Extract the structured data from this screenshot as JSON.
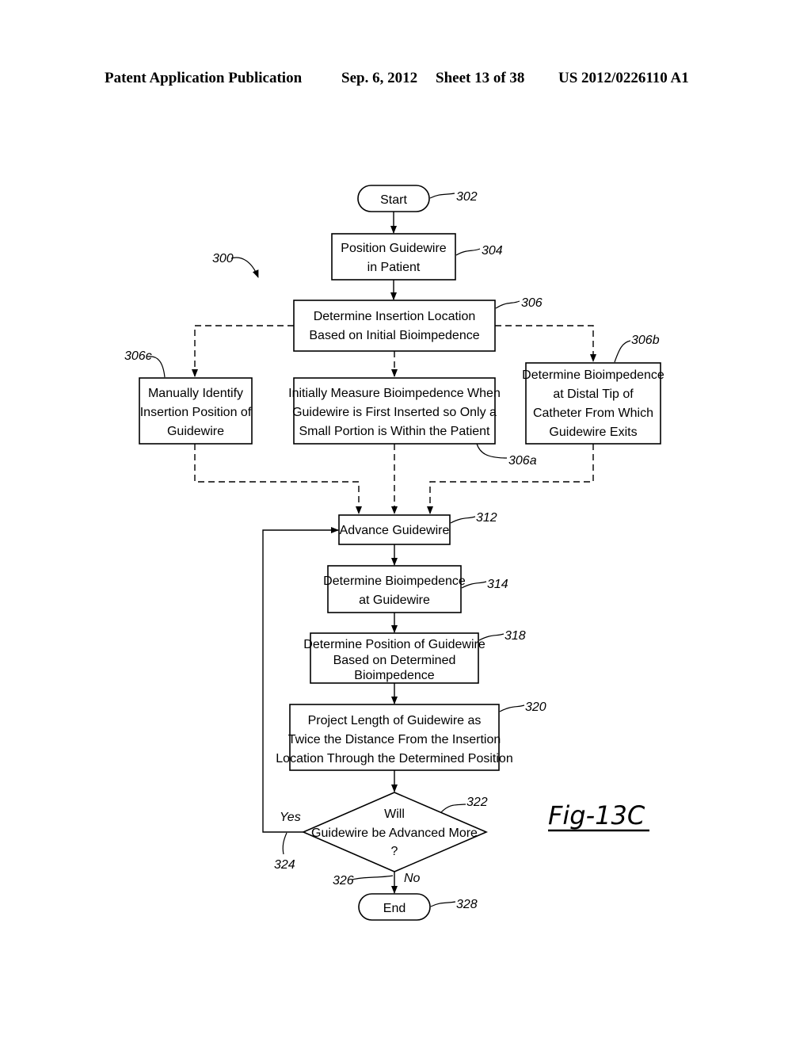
{
  "header": {
    "publication": "Patent Application Publication",
    "date": "Sep. 6, 2012",
    "sheet": "Sheet 13 of 38",
    "number": "US 2012/0226110 A1"
  },
  "figure": {
    "label": "Fig-13C",
    "ref": "300"
  },
  "nodes": {
    "start": {
      "ref": "302",
      "lines": [
        "Start"
      ]
    },
    "n304": {
      "ref": "304",
      "lines": [
        "Position Guidewire",
        "in Patient"
      ]
    },
    "n306": {
      "ref": "306",
      "lines": [
        "Determine Insertion Location",
        "Based on Initial Bioimpedence"
      ]
    },
    "n306c": {
      "ref": "306c",
      "lines": [
        "Manually Identify",
        "Insertion Position of",
        "Guidewire"
      ]
    },
    "n306a": {
      "ref": "306a",
      "lines": [
        "Initially Measure Bioimpedence When",
        "Guidewire is First Inserted so Only a",
        "Small Portion is Within the Patient"
      ]
    },
    "n306b": {
      "ref": "306b",
      "lines": [
        "Determine Bioimpedence",
        "at Distal Tip of",
        "Catheter From Which",
        "Guidewire Exits"
      ]
    },
    "n312": {
      "ref": "312",
      "lines": [
        "Advance Guidewire"
      ]
    },
    "n314": {
      "ref": "314",
      "lines": [
        "Determine Bioimpedence",
        "at Guidewire"
      ]
    },
    "n318": {
      "ref": "318",
      "lines": [
        "Determine Position of Guidewire",
        "Based on Determined",
        "Bioimpedence"
      ]
    },
    "n320": {
      "ref": "320",
      "lines": [
        "Project Length of Guidewire as",
        "Twice the Distance From the Insertion",
        "Location Through the Determined Position"
      ]
    },
    "n322": {
      "ref": "322",
      "lines": [
        "Will",
        "Guidewire be Advanced More",
        "?"
      ]
    },
    "end": {
      "ref": "328",
      "lines": [
        "End"
      ]
    }
  },
  "edges": {
    "yes": {
      "label": "Yes",
      "ref": "324"
    },
    "no": {
      "label": "No",
      "ref": "326"
    }
  }
}
